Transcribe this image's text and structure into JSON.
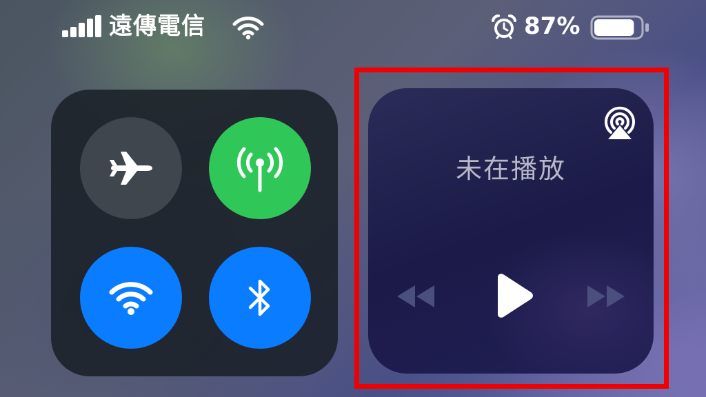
{
  "status_bar": {
    "carrier": "遠傳電信",
    "battery_percent": "87%",
    "battery_level": 0.87,
    "icons": [
      "signal-bars-icon",
      "wifi-icon",
      "alarm-icon",
      "battery-icon"
    ]
  },
  "connectivity": {
    "toggles": [
      {
        "name": "airplane-mode",
        "icon": "airplane-icon",
        "state": "off"
      },
      {
        "name": "cellular-data",
        "icon": "antenna-icon",
        "state": "on",
        "color": "#30c759"
      },
      {
        "name": "wifi",
        "icon": "wifi-icon",
        "state": "on",
        "color": "#0a7cff"
      },
      {
        "name": "bluetooth",
        "icon": "bluetooth-icon",
        "state": "on",
        "color": "#0a7cff"
      }
    ]
  },
  "media": {
    "status": "未在播放",
    "icons": [
      "airplay-icon",
      "rewind-icon",
      "play-icon",
      "fast-forward-icon"
    ]
  },
  "colors": {
    "highlight": "#f00000",
    "accent_blue": "#0a7cff",
    "accent_green": "#30c759"
  }
}
